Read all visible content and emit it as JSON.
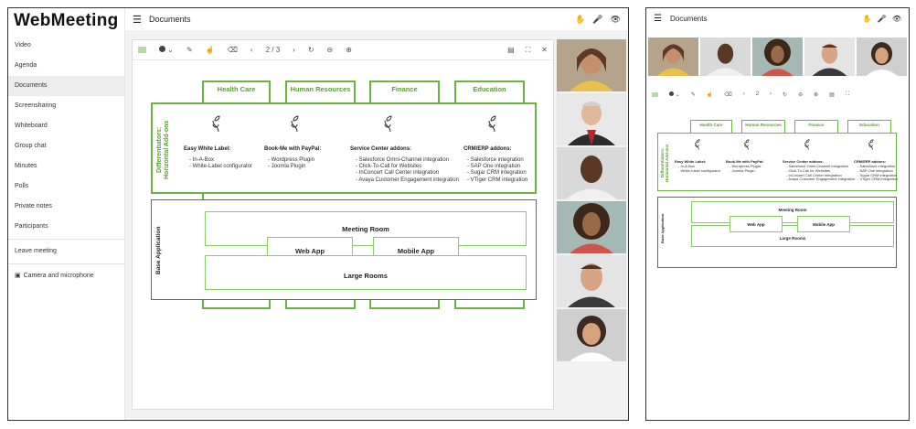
{
  "app": {
    "name": "WebMeeting"
  },
  "sidebar": {
    "items": [
      {
        "label": "Video"
      },
      {
        "label": "Agenda"
      },
      {
        "label": "Documents",
        "active": true
      },
      {
        "label": "Screensharing"
      },
      {
        "label": "Whiteboard"
      },
      {
        "label": "Group chat"
      },
      {
        "label": "Minutes"
      },
      {
        "label": "Polls"
      },
      {
        "label": "Private notes"
      },
      {
        "label": "Participants"
      }
    ],
    "leave": "Leave meeting",
    "camera": "Camera and microphone"
  },
  "header": {
    "title": "Documents",
    "icons": [
      "hand-icon",
      "microphone-icon",
      "eye-icon"
    ]
  },
  "doc_toolbar": {
    "page_desktop": "2 / 3",
    "page_mobile": "2"
  },
  "diagram": {
    "tabs": [
      "Health Care",
      "Human Resources",
      "Finance",
      "Education"
    ],
    "differentiators": "Differentiators:\nHorizontal Add-ons",
    "diff_line1": "Differentiators:",
    "diff_line2": "Horizontal Add-ons",
    "base_label": "Base Application",
    "columns": [
      {
        "title": "Easy White Label:",
        "items": [
          "In-A-Box",
          "White-Label configurator"
        ]
      },
      {
        "title": "Book-Me with PayPal:",
        "items": [
          "Wordpress Plugin",
          "Joomla Plugin"
        ]
      },
      {
        "title": "Service Center addons:",
        "items": [
          "Salesforce Omni-Channel integration",
          "Click-To-Call for Websites",
          "InConcert Call Center integration",
          "Avaya Customer Engagement integration"
        ]
      },
      {
        "title": "CRM/ERP addons:",
        "items": [
          "Salesforce integration",
          "SAP One integration",
          "Sugar CRM integration",
          "VTiger CRM integration"
        ]
      }
    ],
    "meeting_room": "Meeting Room",
    "web_app": "Web App",
    "mobile_app": "Mobile App",
    "large_rooms": "Large Rooms"
  },
  "colors": {
    "accent": "#6cb33f",
    "accent_text": "#5aa02c"
  }
}
